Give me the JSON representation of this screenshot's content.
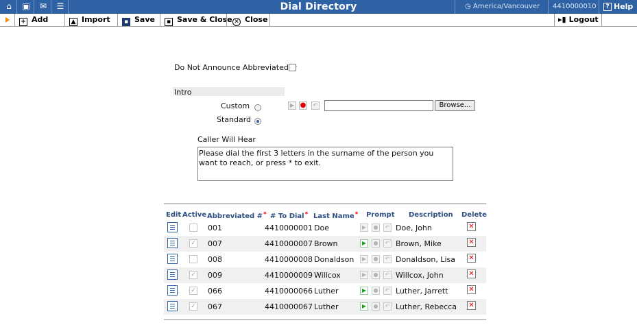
{
  "window": {
    "title": "Dial Directory",
    "timezone": "America/Vancouver",
    "account": "4410000010",
    "help_label": "Help"
  },
  "toolbar": {
    "add": "Add",
    "import": "Import",
    "save": "Save",
    "save_close": "Save & Close",
    "close": "Close",
    "logout": "Logout"
  },
  "form": {
    "do_not_announce_label": "Do Not Announce Abbreviated #",
    "do_not_announce_checked": false,
    "intro_label": "Intro",
    "custom_label": "Custom",
    "standard_label": "Standard",
    "intro_selected": "Standard",
    "custom_file_value": "",
    "browse_label": "Browse...",
    "caller_will_hear_label": "Caller Will Hear",
    "caller_will_hear_text": "Please dial the first 3 letters in the surname of the person you want to reach, or press * to exit."
  },
  "table": {
    "columns": {
      "edit": "Edit",
      "active": "Active",
      "abbrev": "Abbreviated #",
      "todial": "# To Dial",
      "lastname": "Last Name",
      "prompt": "Prompt",
      "description": "Description",
      "delete": "Delete"
    },
    "rows": [
      {
        "active": false,
        "abbrev": "001",
        "todial": "4410000001",
        "lastname": "Doe",
        "prompt_recorded": false,
        "description": "Doe, John"
      },
      {
        "active": true,
        "abbrev": "007",
        "todial": "4410000007",
        "lastname": "Brown",
        "prompt_recorded": true,
        "description": "Brown, Mike"
      },
      {
        "active": false,
        "abbrev": "008",
        "todial": "4410000008",
        "lastname": "Donaldson",
        "prompt_recorded": false,
        "description": "Donaldson, Lisa"
      },
      {
        "active": true,
        "abbrev": "009",
        "todial": "4410000009",
        "lastname": "Willcox",
        "prompt_recorded": false,
        "description": "Willcox, John"
      },
      {
        "active": true,
        "abbrev": "066",
        "todial": "4410000066",
        "lastname": "Luther",
        "prompt_recorded": true,
        "description": "Luther, Jarrett"
      },
      {
        "active": true,
        "abbrev": "067",
        "todial": "4410000067",
        "lastname": "Luther",
        "prompt_recorded": true,
        "description": "Luther, Rebecca"
      }
    ]
  },
  "colors": {
    "title_bar": "#2f62a4",
    "header_text": "#2d4f82",
    "required_marker": "#e60000",
    "delete_icon": "#e00000",
    "play_active": "#1f9d1f"
  }
}
